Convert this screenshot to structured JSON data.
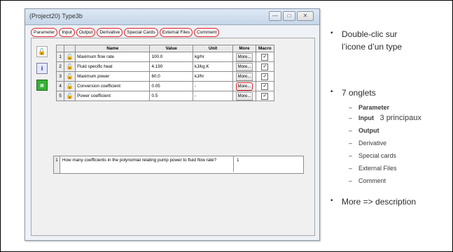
{
  "window": {
    "title": "(Project20) Type3b",
    "minimize_glyph": "—",
    "maximize_glyph": "□",
    "close_glyph": "✕"
  },
  "tabs": [
    "Parameter",
    "Input",
    "Output",
    "Derivative",
    "Special Cards",
    "External Files",
    "Comment"
  ],
  "table": {
    "headers": [
      "Name",
      "Value",
      "Unit",
      "More",
      "Macro"
    ],
    "rows": [
      {
        "num": "1",
        "name": "Maximum flow rate",
        "value": "100.0",
        "unit": "kg/hr",
        "more": "More...",
        "macro": "✓"
      },
      {
        "num": "2",
        "name": "Fluid specific heat",
        "value": "4.190",
        "unit": "kJ/kg.K",
        "more": "More...",
        "macro": "✓"
      },
      {
        "num": "3",
        "name": "Maximum power",
        "value": "60.0",
        "unit": "kJ/hr",
        "more": "More...",
        "macro": "✓"
      },
      {
        "num": "4",
        "name": "Conversion coefficient",
        "value": "0.05",
        "unit": "-",
        "more": "More...",
        "macro": "✓"
      },
      {
        "num": "5",
        "name": "Power coefficient",
        "value": "0.5",
        "unit": "-",
        "more": "More...",
        "macro": "✓"
      }
    ]
  },
  "description": {
    "num": "1",
    "text": "How many coefficients in the polynomial relating pump power to fluid flow rate?",
    "value": "1"
  },
  "notes": {
    "bullet1_line1": "Double-clic sur",
    "bullet1_line2": "l’icone d’un type",
    "bullet2": "7 onglets",
    "sub_dash": "–",
    "sub_parameter": "Parameter",
    "sub_input": "Input",
    "sub_principaux": "3 principaux",
    "sub_output": "Output",
    "sub_derivative": "Derivative",
    "sub_special": "Special cards",
    "sub_external": "External Files",
    "sub_comment": "Comment",
    "bullet3": "More => description"
  },
  "colors": {
    "highlight": "#e0202a"
  }
}
